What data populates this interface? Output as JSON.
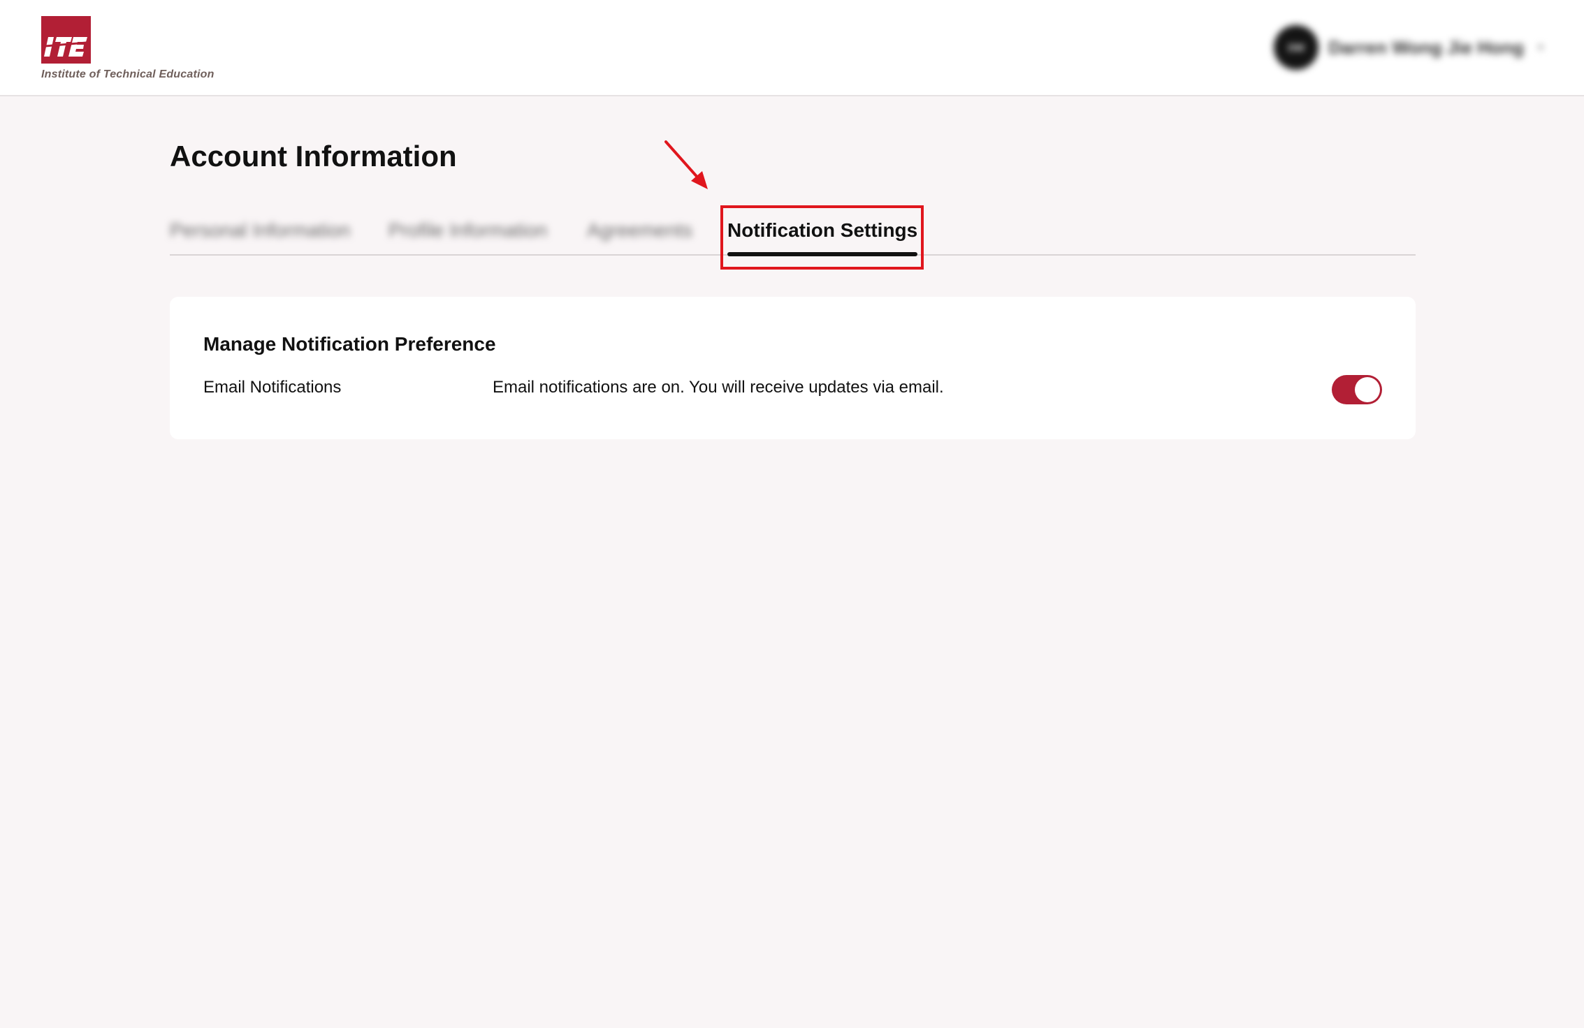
{
  "header": {
    "logo_alt": "ITE",
    "logo_text": "Institute of Technical Education",
    "user": {
      "initials": "DW",
      "name": "Darren Wong Jie Hong",
      "menu_icon": "chevron-down-icon"
    }
  },
  "page": {
    "title": "Account Information"
  },
  "tabs": [
    {
      "label": "Personal Information",
      "active": false
    },
    {
      "label": "Profile Information",
      "active": false
    },
    {
      "label": "Agreements",
      "active": false
    },
    {
      "label": "Notification Settings",
      "active": true
    }
  ],
  "card": {
    "title": "Manage Notification Preference",
    "rows": [
      {
        "label": "Email Notifications",
        "description": "Email notifications are on. You will receive updates via email.",
        "enabled": true
      }
    ]
  },
  "colors": {
    "brand": "#b21f35",
    "annotation": "#e0161d",
    "background": "#f9f5f6"
  }
}
